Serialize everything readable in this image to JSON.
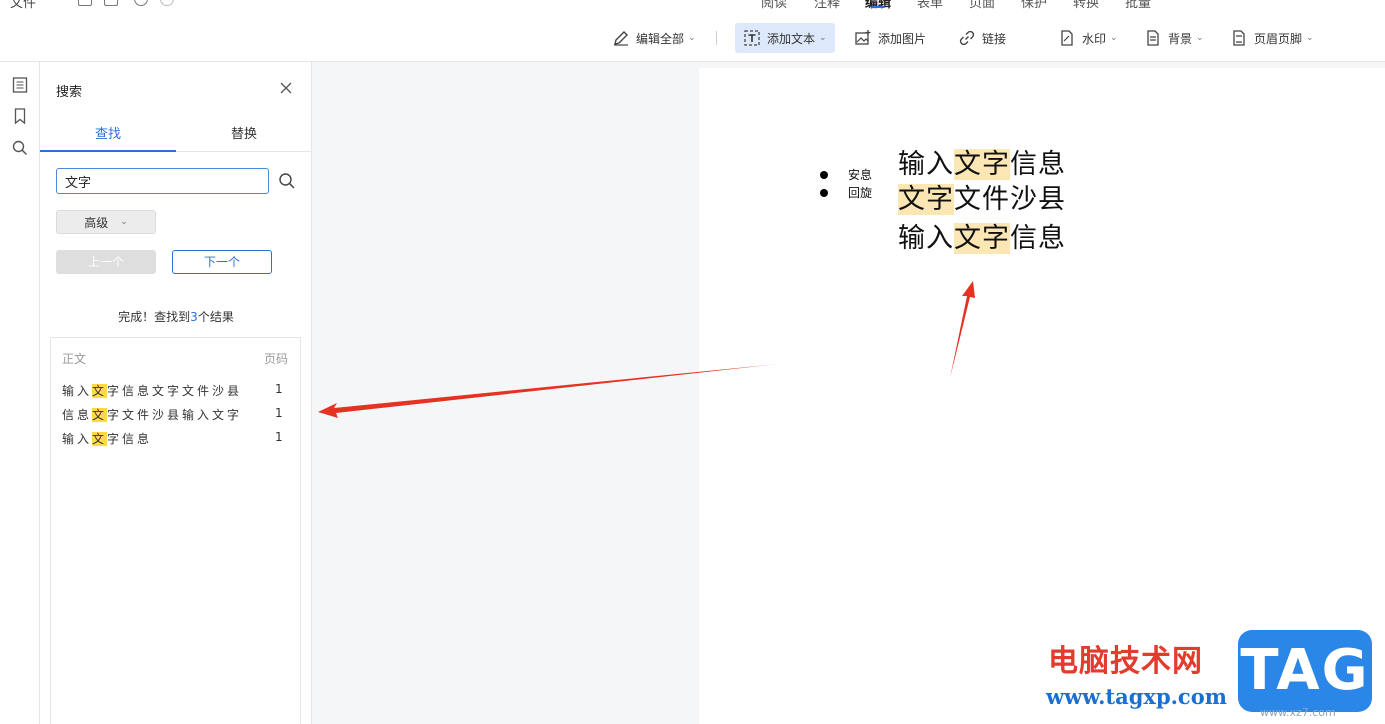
{
  "menubar": {
    "file_label": "文件",
    "tabs": [
      {
        "label": "阅读"
      },
      {
        "label": "注释"
      },
      {
        "label": "编辑"
      },
      {
        "label": "表单"
      },
      {
        "label": "页面"
      },
      {
        "label": "保护"
      },
      {
        "label": "转换"
      },
      {
        "label": "批量"
      }
    ],
    "active_tab": "编辑"
  },
  "toolbar": {
    "edit_all": "编辑全部",
    "add_text": "添加文本",
    "add_image": "添加图片",
    "link": "链接",
    "watermark": "水印",
    "background": "背景",
    "header_footer": "页眉页脚"
  },
  "panel": {
    "title": "搜索",
    "tabs": {
      "find": "查找",
      "replace": "替换"
    },
    "search_value": "文字",
    "advanced": "高级",
    "prev": "上一个",
    "next": "下一个",
    "status_prefix": "完成！查找到",
    "status_count": "3",
    "status_suffix": "个结果",
    "results_header": {
      "text": "正文",
      "page": "页码"
    },
    "results": [
      {
        "before": "输入",
        "match": "文",
        "after": "字信息文字文件沙县",
        "page": "1"
      },
      {
        "before": "信息",
        "match": "文",
        "after": "字文件沙县输入文字",
        "page": "1"
      },
      {
        "before": "输入",
        "match": "文",
        "after": "字信息",
        "page": "1"
      }
    ]
  },
  "document": {
    "bullets": [
      "安息",
      "回旋"
    ],
    "lines": [
      {
        "before": "输入",
        "match": "文字",
        "after": "信息"
      },
      {
        "before": "",
        "match": "文字",
        "after": "文件沙县"
      },
      {
        "before": "输入",
        "match": "文字",
        "after": "信息"
      }
    ]
  },
  "watermark": {
    "site_name": "电脑技术网",
    "url": "www.tagxp.com",
    "tag": "TAG",
    "small": "www.xz7.com"
  },
  "colors": {
    "accent": "#2e6fd6",
    "result_highlight": "#ffd84d",
    "doc_highlight": "#fbe6b4",
    "arrow": "#e53222"
  }
}
